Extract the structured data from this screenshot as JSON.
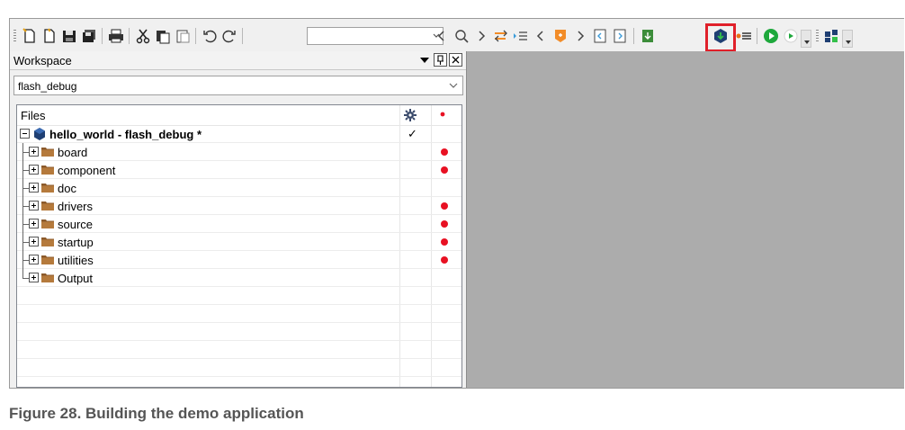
{
  "toolbar": {
    "combo_value": "",
    "icons": [
      "new-file-icon",
      "open-file-icon",
      "save-icon",
      "save-all-icon",
      "print-icon",
      "cut-icon",
      "copy-icon",
      "paste-icon",
      "undo-icon",
      "redo-icon",
      "back-icon",
      "find-icon",
      "forward-icon",
      "toggle-bookmark-icon",
      "goto-line-icon",
      "previous-bookmark-icon",
      "bookmark-icon",
      "next-bookmark-icon",
      "previous-file-icon",
      "next-file-icon",
      "compile-icon",
      "make-build-icon",
      "stop-build-icon",
      "download-debug-icon",
      "debug-without-download-icon",
      "overflow-icon",
      "board-config-icon"
    ],
    "highlight_color": "#e0202a"
  },
  "workspace": {
    "title": "Workspace",
    "configuration": "flash_debug",
    "files_header": "Files",
    "project": {
      "name": "hello_world - flash_debug *",
      "checked": "✓"
    },
    "folders": [
      {
        "name": "board",
        "dirty": true
      },
      {
        "name": "component",
        "dirty": true
      },
      {
        "name": "doc",
        "dirty": false
      },
      {
        "name": "drivers",
        "dirty": true
      },
      {
        "name": "source",
        "dirty": true
      },
      {
        "name": "startup",
        "dirty": true
      },
      {
        "name": "utilities",
        "dirty": true
      },
      {
        "name": "Output",
        "dirty": false
      }
    ]
  },
  "caption": "Figure 28.  Building the demo application"
}
